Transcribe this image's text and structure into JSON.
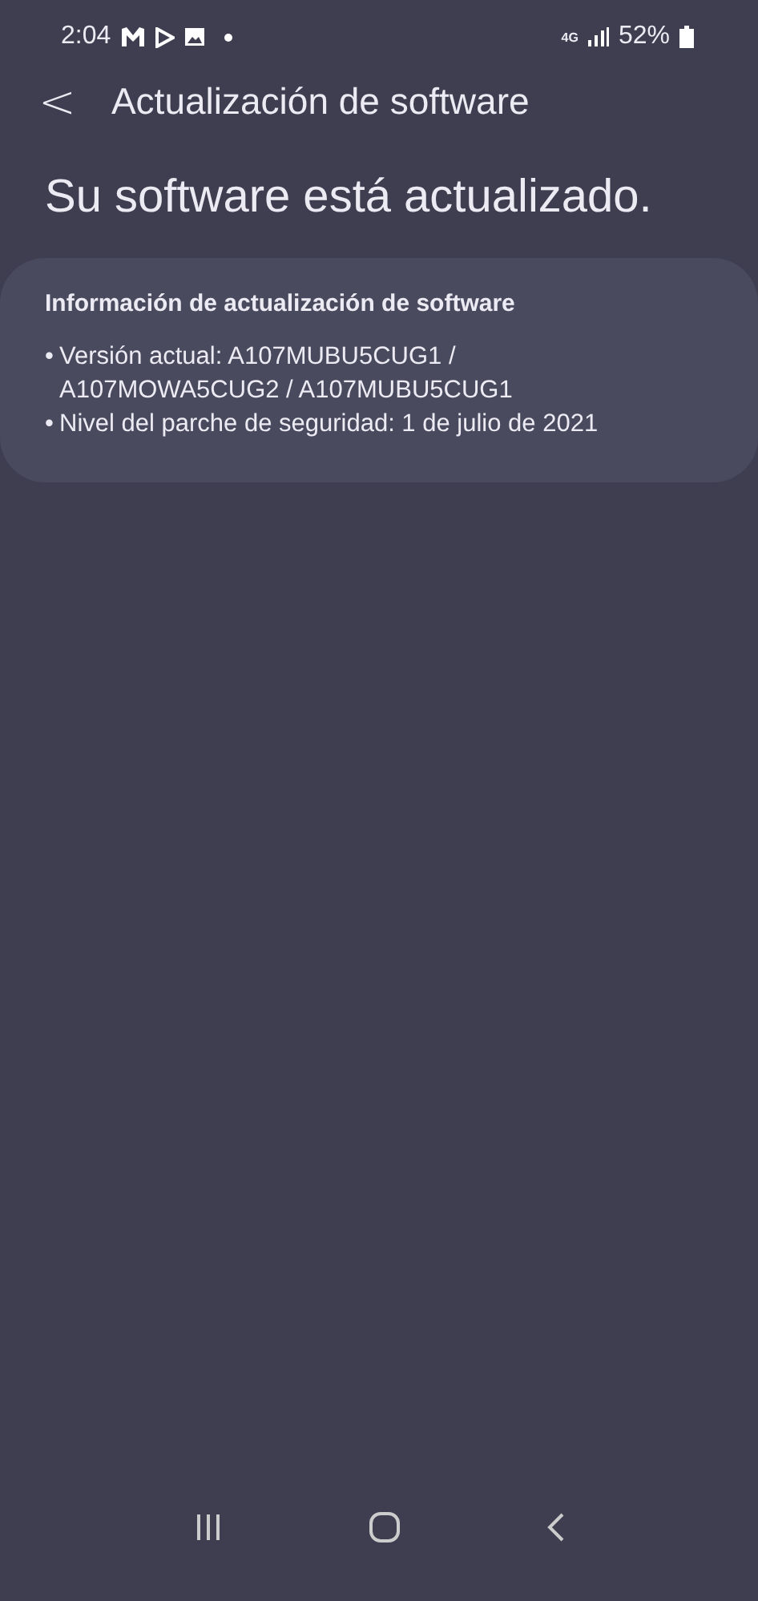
{
  "status_bar": {
    "time": "2:04",
    "network": "4G",
    "battery": "52%"
  },
  "header": {
    "back": "<",
    "title": "Actualización de software"
  },
  "headline": "Su software está actualizado.",
  "info_card": {
    "title": "Información de actualización de software",
    "items": [
      {
        "bullet": "•",
        "text": "Versión actual: A107MUBU5CUG1 /\nA107MOWA5CUG2 / A107MUBU5CUG1"
      },
      {
        "bullet": "•",
        "text": "Nivel del parche de seguridad: 1 de julio de 2021"
      }
    ]
  }
}
